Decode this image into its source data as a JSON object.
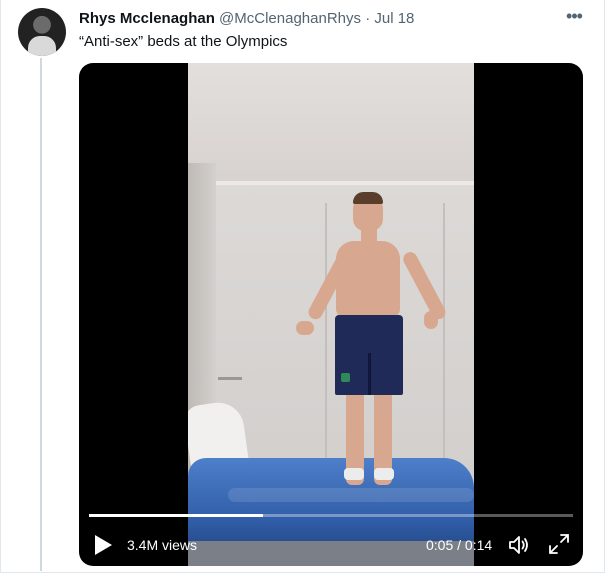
{
  "tweet": {
    "display_name": "Rhys Mcclenaghan",
    "handle": "@McClenaghanRhys",
    "separator": "·",
    "date": "Jul 18",
    "more_icon": "more-horizontal-icon",
    "text": "“Anti-sex” beds at the Olympics"
  },
  "video": {
    "views": "3.4M views",
    "time": "0:05 / 0:14",
    "progress": 0.36,
    "play_icon": "play-icon",
    "volume_icon": "volume-icon",
    "fullscreen_icon": "fullscreen-icon"
  },
  "colors": {
    "name": "#0f1419",
    "secondary": "#536471",
    "thread_line": "#cfd9de",
    "video_bg": "#000000"
  }
}
